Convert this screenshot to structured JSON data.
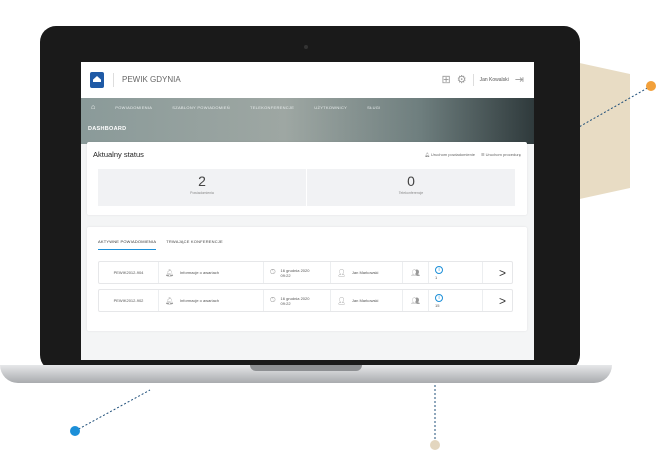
{
  "app": {
    "brand": "PEWIK GDYNIA",
    "user_name": "Jan Kowalski"
  },
  "nav": {
    "items": [
      {
        "label": "POWIADOMIENIA"
      },
      {
        "label": "SZABLONY POWIADOMIEŃ"
      },
      {
        "label": "TELEKONFERENCJE"
      },
      {
        "label": "UŻYTKOWNICY"
      },
      {
        "label": "SŁUGI"
      }
    ],
    "page_title": "DASHBOARD"
  },
  "status": {
    "title": "Aktualny status",
    "actions": {
      "start_notification": "Uruchom powiadomienie",
      "start_procedure": "Uruchom procedurę"
    },
    "counters": [
      {
        "value": "2",
        "label": "Powiadomienia"
      },
      {
        "value": "0",
        "label": "Telekonferencje"
      }
    ]
  },
  "list": {
    "tabs": [
      {
        "label": "AKTYWNE POWIADOMIENIA",
        "active": true
      },
      {
        "label": "TRWAJĄCE KONFERENCJE",
        "active": false
      }
    ],
    "rows": [
      {
        "id": "PEWIK2012-904",
        "type": "Informacje o awariach",
        "date": "16 grudnia 2020",
        "time": "09:22",
        "user": "Jan Markowski",
        "info": "1"
      },
      {
        "id": "PEWIK2012-902",
        "type": "Informacje o awariach",
        "date": "16 grudnia 2020",
        "time": "09:22",
        "user": "Jan Markowski",
        "info": "15"
      }
    ]
  },
  "colors": {
    "accent": "#1c8fd8",
    "orange_dot": "#f2a03a",
    "hexagon": "#e8dcc4"
  }
}
